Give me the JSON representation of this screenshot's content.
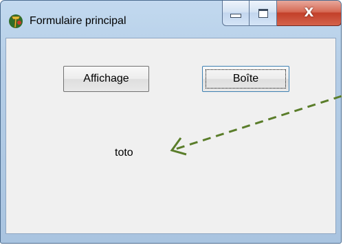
{
  "window": {
    "title": "Formulaire principal",
    "controls": {
      "close_glyph": "X"
    }
  },
  "form": {
    "button_affichage": "Affichage",
    "button_boite": "Boîte",
    "label_text": "toto"
  },
  "annotation": {
    "arrow_color": "#5a7d2a",
    "style": "dashed"
  },
  "colors": {
    "client_bg": "#f0f0f0",
    "frame": "#b4cde6",
    "close_red": "#c2402a"
  }
}
